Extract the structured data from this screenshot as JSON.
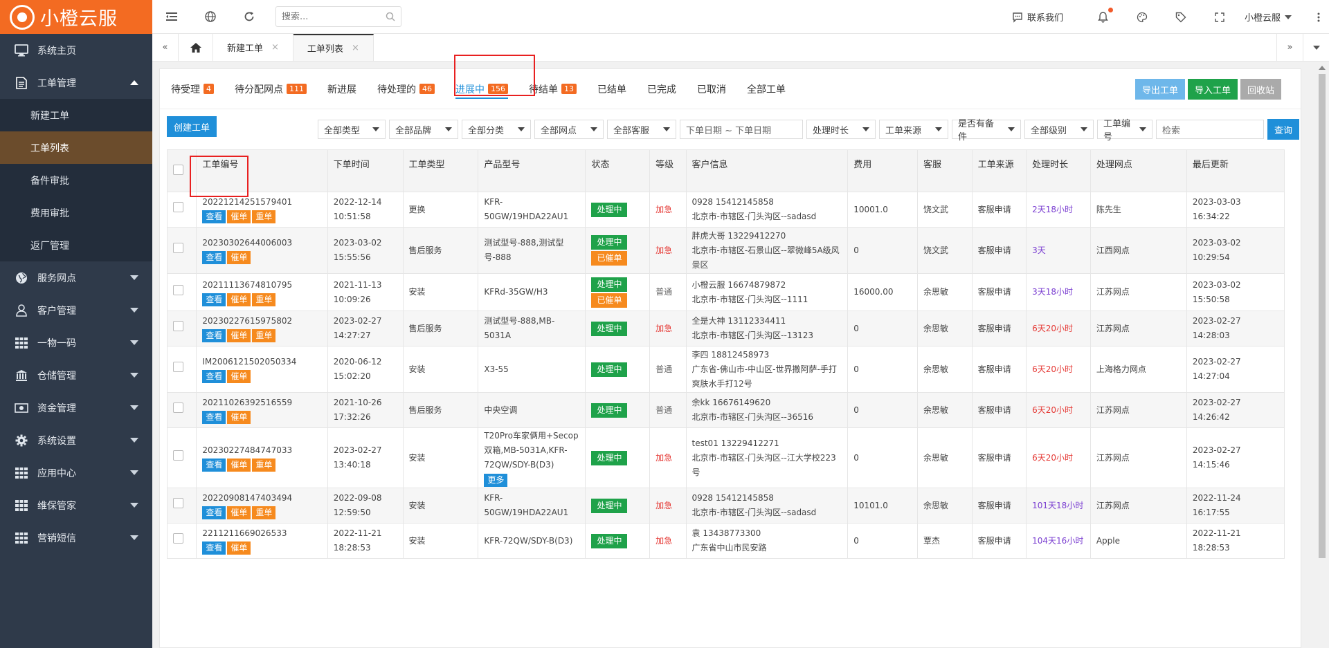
{
  "app": {
    "name": "小橙云服"
  },
  "sidebar": {
    "items": [
      {
        "label": "系统主页",
        "icon": "monitor-icon"
      },
      {
        "label": "工单管理",
        "icon": "document-icon",
        "open": true,
        "children": [
          {
            "label": "新建工单"
          },
          {
            "label": "工单列表",
            "active": true
          },
          {
            "label": "备件审批"
          },
          {
            "label": "费用审批"
          },
          {
            "label": "返厂管理"
          }
        ]
      },
      {
        "label": "服务网点",
        "icon": "globe-icon"
      },
      {
        "label": "客户管理",
        "icon": "user-icon"
      },
      {
        "label": "一物一码",
        "icon": "grid-icon"
      },
      {
        "label": "仓储管理",
        "icon": "bank-icon"
      },
      {
        "label": "资金管理",
        "icon": "money-icon"
      },
      {
        "label": "系统设置",
        "icon": "gear-icon"
      },
      {
        "label": "应用中心",
        "icon": "grid-icon"
      },
      {
        "label": "维保管家",
        "icon": "grid-icon"
      },
      {
        "label": "营销短信",
        "icon": "grid-icon"
      }
    ]
  },
  "header": {
    "search_placeholder": "搜索...",
    "contact": "联系我们",
    "user": "小橙云服"
  },
  "page_tabs": [
    {
      "label": "新建工单"
    },
    {
      "label": "工单列表",
      "active": true
    }
  ],
  "status_tabs": [
    {
      "label": "待受理",
      "badge": "4"
    },
    {
      "label": "待分配网点",
      "badge": "111"
    },
    {
      "label": "新进展",
      "badge": ""
    },
    {
      "label": "待处理的",
      "badge": "46"
    },
    {
      "label": "进展中",
      "badge": "156",
      "active": true
    },
    {
      "label": "待结单",
      "badge": "13"
    },
    {
      "label": "已结单",
      "badge": ""
    },
    {
      "label": "已完成",
      "badge": ""
    },
    {
      "label": "已取消",
      "badge": ""
    },
    {
      "label": "全部工单",
      "badge": ""
    }
  ],
  "actions": {
    "export": "导出工单",
    "import": "导入工单",
    "recycle": "回收站"
  },
  "filters": {
    "create": "创建工单",
    "type": "全部类型",
    "brand": "全部品牌",
    "category": "全部分类",
    "outlet": "全部网点",
    "service": "全部客服",
    "date_placeholder": "下单日期 ~ 下单日期",
    "duration": "处理时长",
    "source": "工单来源",
    "parts": "是否有备件",
    "level": "全部级别",
    "field": "工单编号",
    "keyword_placeholder": "检索",
    "query": "查询"
  },
  "table": {
    "headers": [
      "工单编号",
      "下单时间",
      "工单类型",
      "产品型号",
      "状态",
      "等级",
      "客户信息",
      "费用",
      "客服",
      "工单来源",
      "处理时长",
      "处理网点",
      "最后更新"
    ],
    "btn_view": "查看",
    "btn_urge": "催单",
    "btn_dup": "重单",
    "btn_more": "更多",
    "rows": [
      {
        "id": "20221214251579401",
        "dup": true,
        "date": "2022-12-14",
        "time": "10:51:58",
        "type": "更换",
        "model": "KFR-50GW/19HDA22AU1",
        "states": [
          "处理中"
        ],
        "level": "加急",
        "customer": "0928 15412145858",
        "address": "北京市-市辖区-门头沟区--sadasd",
        "fee": "10001.0",
        "service": "饶文武",
        "source": "客服申请",
        "duration": "2天18小时",
        "outlet": "陈先生",
        "upd_date": "2023-03-03",
        "upd_time": "16:34:22"
      },
      {
        "id": "20230302644006003",
        "dup": false,
        "date": "2023-03-02",
        "time": "15:55:56",
        "type": "售后服务",
        "model": "测试型号-888,测试型号-888",
        "states": [
          "处理中",
          "已催单"
        ],
        "level": "加急",
        "customer": "胖虎大哥 13229412270",
        "address": "北京市-市辖区-石景山区--翠微峰5A级风景区",
        "fee": "0",
        "service": "饶文武",
        "source": "客服申请",
        "duration": "3天",
        "outlet": "江西网点",
        "upd_date": "2023-03-02",
        "upd_time": "10:29:54"
      },
      {
        "id": "20211113674810795",
        "dup": true,
        "date": "2021-11-13",
        "time": "10:09:26",
        "type": "安装",
        "model": "KFRd-35GW/H3",
        "states": [
          "处理中",
          "已催单"
        ],
        "level": "普通",
        "customer": "小橙云服 16674879872",
        "address": "北京市-市辖区-门头沟区--1111",
        "fee": "16000.00",
        "service": "余思敏",
        "source": "客服申请",
        "duration": "3天18小时",
        "outlet": "江苏网点",
        "upd_date": "2023-03-02",
        "upd_time": "15:50:58"
      },
      {
        "id": "20230227615975802",
        "dup": true,
        "date": "2023-02-27",
        "time": "14:27:27",
        "type": "售后服务",
        "model": "测试型号-888,MB-5031A",
        "states": [
          "处理中"
        ],
        "level": "加急",
        "customer": "全是大神 13112334411",
        "address": "北京市-市辖区-门头沟区--13123",
        "fee": "0",
        "service": "余思敏",
        "source": "客服申请",
        "duration": "6天20小时",
        "outlet": "江苏网点",
        "upd_date": "2023-02-27",
        "upd_time": "14:28:03"
      },
      {
        "id": "IM2006121502050334",
        "dup": false,
        "date": "2020-06-12",
        "time": "15:02:20",
        "type": "安装",
        "model": "X3-55",
        "states": [
          "处理中"
        ],
        "level": "普通",
        "customer": "李四 18812458973",
        "address": "广东省-佛山市-中山区-世界撒阿萨-手打爽肤水手打12号",
        "fee": "0",
        "service": "余思敏",
        "source": "客服申请",
        "duration": "6天20小时",
        "outlet": "上海格力网点",
        "upd_date": "2023-02-27",
        "upd_time": "14:27:04"
      },
      {
        "id": "20211026392516559",
        "dup": false,
        "date": "2021-10-26",
        "time": "17:32:26",
        "type": "售后服务",
        "model": "中央空调",
        "states": [
          "处理中"
        ],
        "level": "普通",
        "customer": "余kk 16676149620",
        "address": "北京市-市辖区-门头沟区--36516",
        "fee": "0",
        "service": "余思敏",
        "source": "客服申请",
        "duration": "6天20小时",
        "outlet": "江苏网点",
        "upd_date": "2023-02-27",
        "upd_time": "14:26:42"
      },
      {
        "id": "20230227484747033",
        "dup": true,
        "date": "2023-02-27",
        "time": "13:40:18",
        "type": "安装",
        "model": "T20Pro车家俩用+Secop双箱,MB-5031A,KFR-72QW/SDY-B(D3)",
        "more": true,
        "states": [
          "处理中"
        ],
        "level": "加急",
        "customer": "test01 13229412271",
        "address": "北京市-市辖区-门头沟区--江大学校223号",
        "fee": "0",
        "service": "余思敏",
        "source": "客服申请",
        "duration": "6天20小时",
        "outlet": "江苏网点",
        "upd_date": "2023-02-27",
        "upd_time": "14:15:46"
      },
      {
        "id": "20220908147403494",
        "dup": true,
        "date": "2022-09-08",
        "time": "12:59:50",
        "type": "安装",
        "model": "KFR-50GW/19HDA22AU1",
        "states": [
          "处理中"
        ],
        "level": "加急",
        "customer": "0928 15412145858",
        "address": "北京市-市辖区-门头沟区--sadasd",
        "fee": "10101.0",
        "service": "余思敏",
        "source": "客服申请",
        "duration": "101天18小时",
        "outlet": "江苏网点",
        "upd_date": "2022-11-24",
        "upd_time": "16:17:55"
      },
      {
        "id": "2211211669026533",
        "dup": false,
        "date": "2022-11-21",
        "time": "18:28:53",
        "type": "安装",
        "model": "KFR-72QW/SDY-B(D3)",
        "states": [
          "处理中"
        ],
        "level": "加急",
        "customer": "袁 13438773300",
        "address": "广东省中山市民安路",
        "fee": "0",
        "service": "覃杰",
        "source": "客服申请",
        "duration": "104天16小时",
        "outlet": "Apple",
        "upd_date": "2022-11-21",
        "upd_time": "18:28:53"
      }
    ]
  }
}
